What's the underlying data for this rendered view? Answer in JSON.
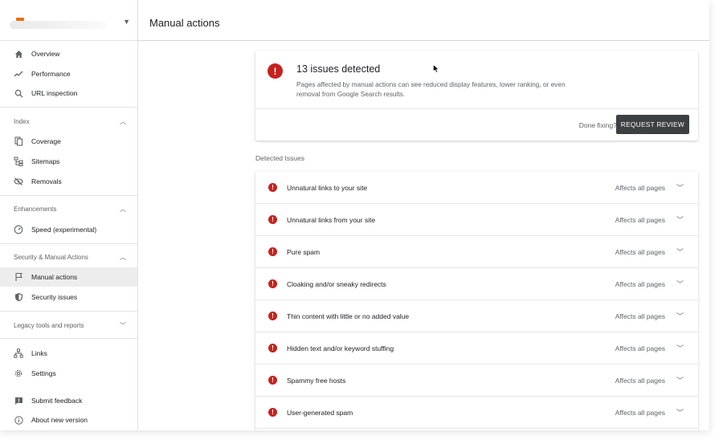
{
  "header": {
    "title": "Manual actions"
  },
  "sidebar": {
    "top_items": [
      {
        "label": "Overview",
        "icon": "home-icon"
      },
      {
        "label": "Performance",
        "icon": "trending-icon"
      },
      {
        "label": "URL inspection",
        "icon": "search-icon"
      }
    ],
    "sections": [
      {
        "title": "Index",
        "items": [
          {
            "label": "Coverage",
            "icon": "copy-icon"
          },
          {
            "label": "Sitemaps",
            "icon": "sitemap-icon"
          },
          {
            "label": "Removals",
            "icon": "eye-off-icon"
          }
        ]
      },
      {
        "title": "Enhancements",
        "items": [
          {
            "label": "Speed (experimental)",
            "icon": "speed-icon"
          }
        ]
      },
      {
        "title": "Security & Manual Actions",
        "items": [
          {
            "label": "Manual actions",
            "icon": "flag-icon",
            "active": true
          },
          {
            "label": "Security issues",
            "icon": "shield-icon"
          }
        ]
      },
      {
        "title": "Legacy tools and reports",
        "items": []
      }
    ],
    "bottom_items": [
      {
        "label": "Links",
        "icon": "network-icon"
      },
      {
        "label": "Settings",
        "icon": "gear-icon"
      },
      {
        "label": "Submit feedback",
        "icon": "feedback-icon"
      },
      {
        "label": "About new version",
        "icon": "info-icon"
      }
    ]
  },
  "summary": {
    "headline": "13 issues detected",
    "description": "Pages affected by manual actions can see reduced display features, lower ranking, or even removal from Google Search results.",
    "done_text": "Done fixing?",
    "button_label": "REQUEST REVIEW"
  },
  "detected_label": "Detected Issues",
  "issues": [
    {
      "label": "Unnatural links to your site",
      "scope": "Affects all pages"
    },
    {
      "label": "Unnatural links from your site",
      "scope": "Affects all pages"
    },
    {
      "label": "Pure spam",
      "scope": "Affects all pages"
    },
    {
      "label": "Cloaking and/or sneaky redirects",
      "scope": "Affects all pages"
    },
    {
      "label": "Thin content with little or no added value",
      "scope": "Affects all pages"
    },
    {
      "label": "Hidden text and/or keyword stuffing",
      "scope": "Affects all pages"
    },
    {
      "label": "Spammy free hosts",
      "scope": "Affects all pages"
    },
    {
      "label": "User-generated spam",
      "scope": "Affects all pages"
    }
  ],
  "colors": {
    "alert": "#c5221f",
    "button": "#3c4043",
    "brand": "#e8710a"
  }
}
